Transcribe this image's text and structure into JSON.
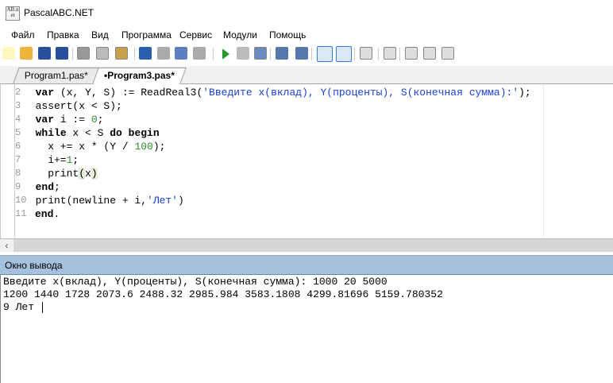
{
  "window": {
    "title": "PascalABC.NET",
    "icon_text": "AB.net"
  },
  "menu": [
    "Файл",
    "Правка",
    "Вид",
    "Программа",
    "Сервис",
    "Модули",
    "Помощь"
  ],
  "toolbar": [
    "new-file-icon",
    "open-icon",
    "save-icon",
    "save-all-icon",
    "cut-icon",
    "copy-icon",
    "paste-icon",
    "undo-icon",
    "redo-icon",
    "indent-icon",
    "unindent-icon",
    "run-icon",
    "stop-icon",
    "compile-icon",
    "step-into-icon",
    "step-over-icon",
    "console-icon",
    "text-icon",
    "format-icon",
    "code-icon",
    "doc-d-icon",
    "doc-l-icon",
    "doc-r-icon"
  ],
  "tabs": [
    {
      "label": "Program1.pas*",
      "active": false
    },
    {
      "label": "•Program3.pas*",
      "active": true
    }
  ],
  "editor": {
    "lines": [
      {
        "n": "2",
        "code": "  var (x, Y, S) := ReadReal3('Введите x(вклад), Y(проценты), S(конечная сумма):');"
      },
      {
        "n": "3",
        "code": "  assert(x < S);"
      },
      {
        "n": "4",
        "code": "  var i := 0;"
      },
      {
        "n": "5",
        "code": "  while x < S do begin"
      },
      {
        "n": "6",
        "code": "    x += x * (Y / 100);"
      },
      {
        "n": "7",
        "code": "    i+=1;"
      },
      {
        "n": "8",
        "code": "    print(x)"
      },
      {
        "n": "9",
        "code": "  end;"
      },
      {
        "n": "10",
        "code": "  print(newline + i,'Лет')"
      },
      {
        "n": "11",
        "code": "end."
      }
    ]
  },
  "output": {
    "title": "Окно вывода",
    "lines": [
      "Введите x(вклад), Y(проценты), S(конечная сумма): 1000 20 5000",
      "1200 1440 1728 2073.6 2488.32 2985.984 3583.1808 4299.81696 5159.780352",
      "9 Лет "
    ]
  },
  "colors": {
    "string": "#1a3fd6",
    "number": "#2e8b2e",
    "output_header": "#a6c1de"
  }
}
